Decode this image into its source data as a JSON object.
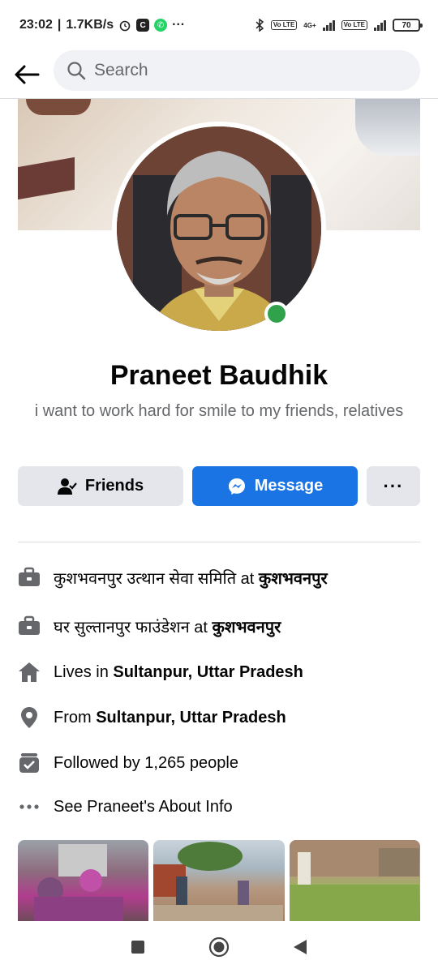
{
  "status_bar": {
    "time": "23:02",
    "net_speed": "1.7KB/s",
    "app_badge": "C",
    "battery": "70",
    "lte1": "Vo LTE",
    "lte2": "Vo LTE",
    "network_type": "4G+"
  },
  "header": {
    "search_placeholder": "Search"
  },
  "profile": {
    "name": "Praneet Baudhik",
    "bio": "i want to work hard for smile to my friends, relatives",
    "online": true
  },
  "actions": {
    "friends_label": "Friends",
    "message_label": "Message",
    "more_label": "···"
  },
  "info": {
    "work1_prefix": "कुशभवनपुर उत्थान सेवा समिति at ",
    "work1_place": "कुशभवनपुर",
    "work2_prefix": "घर सुल्तानपुर फाउंडेशन at ",
    "work2_place": "कुशभवनपुर",
    "lives_prefix": "Lives in ",
    "lives_place": "Sultanpur, Uttar Pradesh",
    "from_prefix": "From ",
    "from_place": "Sultanpur, Uttar Pradesh",
    "followers": "Followed by 1,265 people",
    "about_link": "See Praneet's About Info"
  },
  "colors": {
    "accent": "#1b74e4",
    "online": "#31a24c",
    "secondary_text": "#65676b"
  }
}
